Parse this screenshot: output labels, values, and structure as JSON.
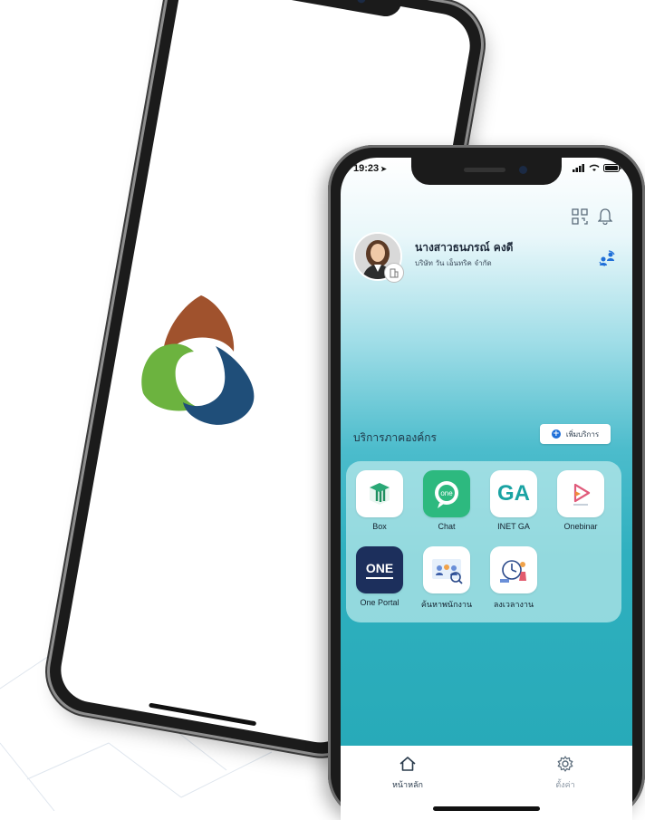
{
  "status_bar": {
    "time": "19:23"
  },
  "profile": {
    "name": "นางสาวธนภรณ์ คงดี",
    "company": "บริษัท วัน เอ็นทริค จำกัด"
  },
  "services": {
    "title": "บริการภาคองค์กร",
    "add_label": "เพิ่มบริการ",
    "items": [
      {
        "label": "Box",
        "icon": "box-icon"
      },
      {
        "label": "Chat",
        "icon": "chat-icon",
        "icon_text": "one"
      },
      {
        "label": "INET GA",
        "icon": "ga-icon",
        "icon_text": "GA"
      },
      {
        "label": "Onebinar",
        "icon": "onebinar-icon"
      },
      {
        "label": "One Portal",
        "icon": "one-portal-icon",
        "icon_text": "ONE"
      },
      {
        "label": "ค้นหาพนักงาน",
        "icon": "employee-search-icon"
      },
      {
        "label": "ลงเวลางาน",
        "icon": "time-attendance-icon"
      }
    ]
  },
  "bottom_nav": {
    "home_label": "หน้าหลัก",
    "settings_label": "ตั้งค่า"
  },
  "colors": {
    "teal": "#2fb0bf",
    "logo_brown": "#a0522d",
    "logo_green": "#6cb33f",
    "logo_blue": "#1f4e79",
    "chat_green": "#2db97f",
    "ga_teal": "#1aa3a3",
    "portal_navy": "#1c2f5c"
  }
}
